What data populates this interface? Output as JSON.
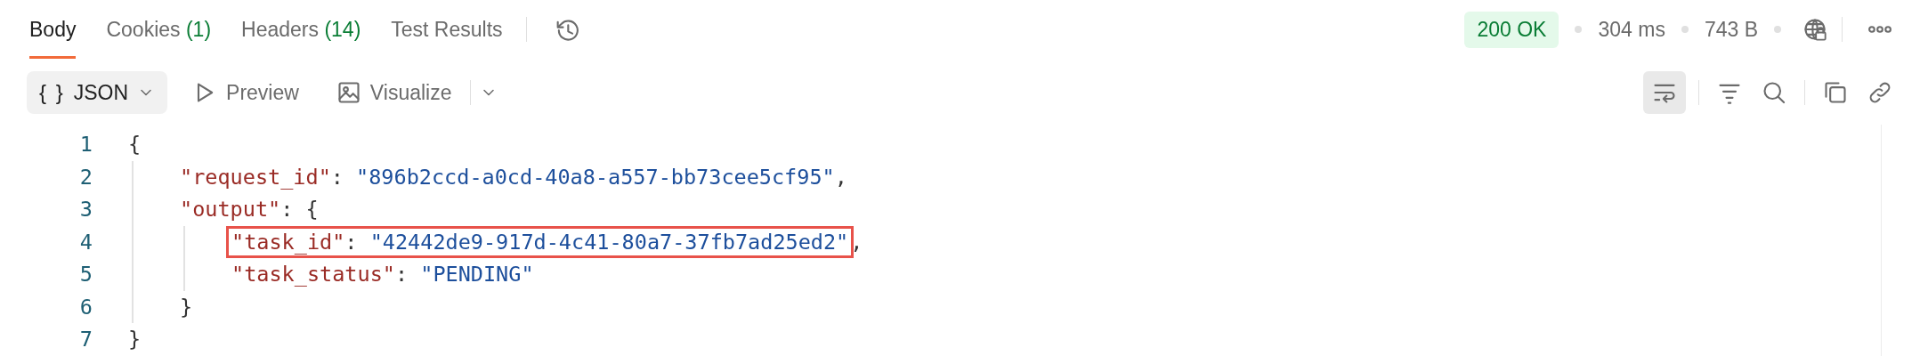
{
  "tabs": [
    {
      "label": "Body",
      "selected": true
    },
    {
      "label": "Cookies",
      "count": "(1)",
      "selected": false
    },
    {
      "label": "Headers",
      "count": "(14)",
      "selected": false
    },
    {
      "label": "Test Results",
      "selected": false
    }
  ],
  "response": {
    "status": "200 OK",
    "time": "304 ms",
    "size": "743 B"
  },
  "view_modes": [
    {
      "kind": "format",
      "icon": "{ }",
      "label": "JSON",
      "selected": true
    },
    {
      "kind": "preview",
      "label": "Preview",
      "selected": false
    },
    {
      "kind": "visualize",
      "label": "Visualize",
      "selected": false
    }
  ],
  "wrap_lines": {
    "on": true
  },
  "editor": {
    "lines": [
      {
        "number": "1",
        "tokens": [
          {
            "kind": "punct",
            "text": "{"
          }
        ],
        "children": [
          {
            "number": "2",
            "tokens": [
              {
                "kind": "key",
                "text": "\"request_id\""
              },
              {
                "kind": "punct",
                "text": ": "
              },
              {
                "kind": "string",
                "text": "\"896b2ccd-a0cd-40a8-a557-bb73cee5cf95\""
              },
              {
                "kind": "punct",
                "text": ","
              }
            ]
          },
          {
            "number": "3",
            "tokens": [
              {
                "kind": "key",
                "text": "\"output\""
              },
              {
                "kind": "punct",
                "text": ": {"
              }
            ],
            "children": [
              {
                "number": "4",
                "tokens": [
                  {
                    "kind": "key",
                    "text": "\"task_id\"",
                    "highlighted": true
                  },
                  {
                    "kind": "punct",
                    "text": ": ",
                    "highlighted": true
                  },
                  {
                    "kind": "string",
                    "text": "\"42442de9-917d-4c41-80a7-37fb7ad25ed2\"",
                    "highlighted": true
                  },
                  {
                    "kind": "punct",
                    "text": ",",
                    "highlighted": false
                  }
                ]
              },
              {
                "number": "5",
                "tokens": [
                  {
                    "kind": "key",
                    "text": "\"task_status\""
                  },
                  {
                    "kind": "punct",
                    "text": ": "
                  },
                  {
                    "kind": "string",
                    "text": "\"PENDING\""
                  }
                ]
              }
            ]
          },
          {
            "number": "6",
            "tokens": [
              {
                "kind": "punct",
                "text": "}"
              }
            ]
          }
        ]
      },
      {
        "number": "7",
        "tokens": [
          {
            "kind": "punct",
            "text": "}"
          }
        ]
      }
    ]
  }
}
